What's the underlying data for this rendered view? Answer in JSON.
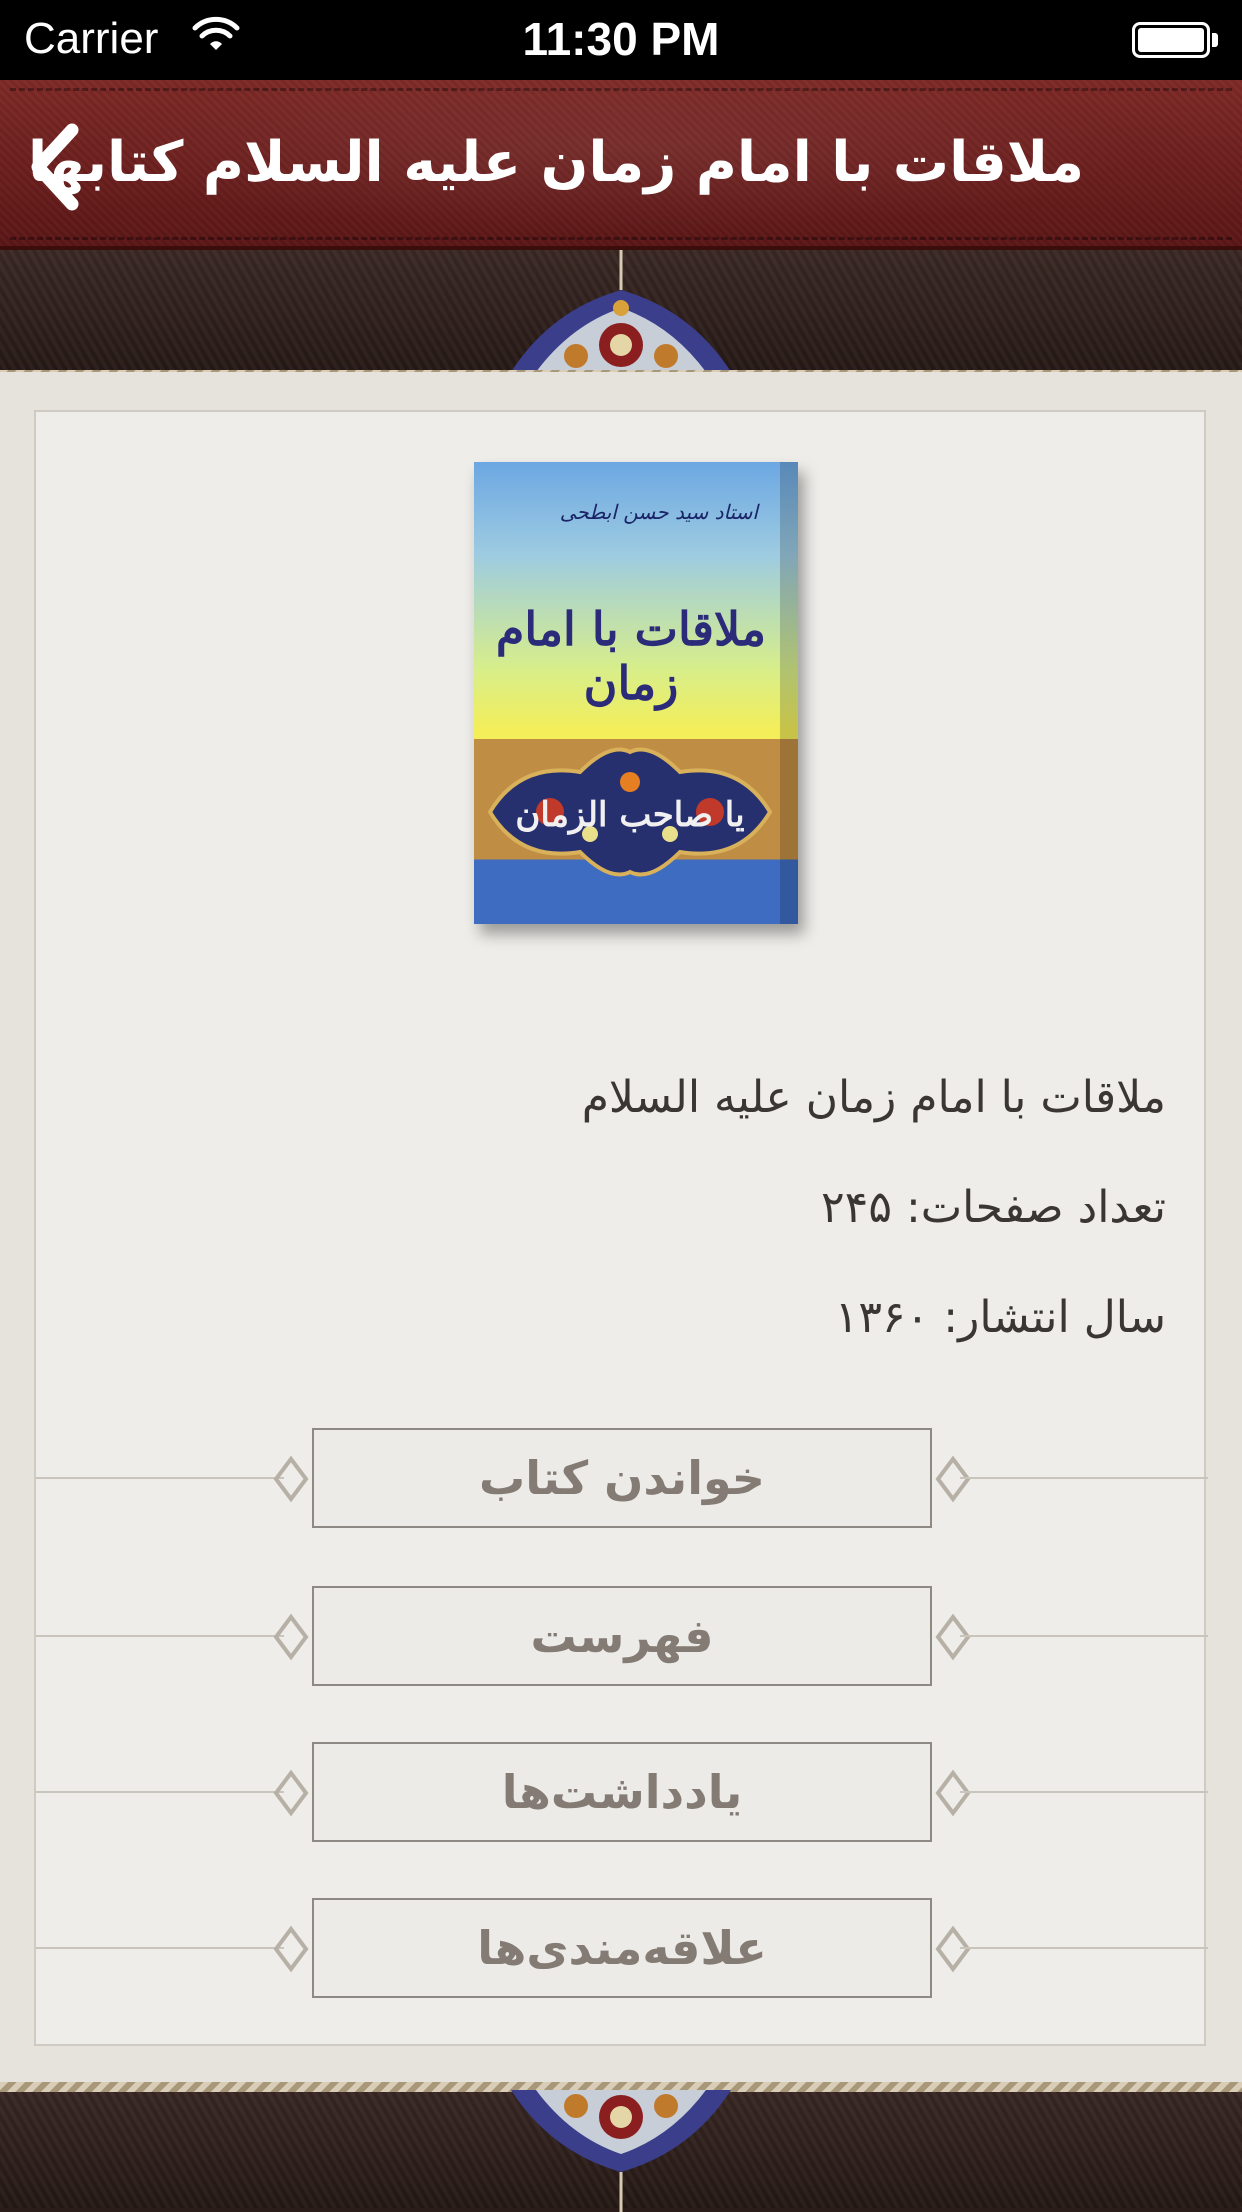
{
  "status_bar": {
    "carrier": "Carrier",
    "time": "11:30 PM"
  },
  "nav": {
    "title": "ملاقات با امام زمان علیه السلام کتابها",
    "back_icon": "chevron-left-icon"
  },
  "book": {
    "cover": {
      "author": "استاد سید حسن ابطحی",
      "title": "ملاقات با امام زمان",
      "banner": "یا صاحب الزمان"
    },
    "title": "ملاقات با امام زمان علیه السلام",
    "pages": "تعداد صفحات: ۲۴۵",
    "year": "سال انتشار: ۱۳۶۰"
  },
  "buttons": {
    "read": "خواندن کتاب",
    "contents": "فهرست",
    "notes": "یادداشت‌ها",
    "favorites": "علاقه‌مندی‌ها"
  },
  "colors": {
    "nav_red": "#6b1f1c",
    "leather_dark": "#2f211e",
    "paper": "#eeede9",
    "button_text": "#837b74"
  }
}
